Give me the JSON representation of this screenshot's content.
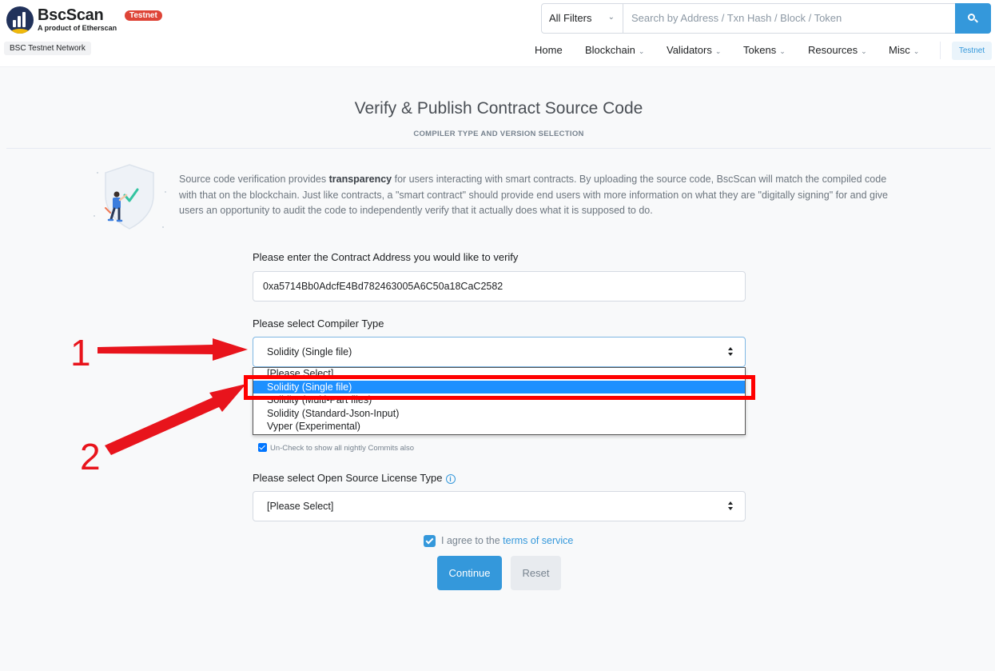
{
  "header": {
    "logo_name": "BscScan",
    "logo_sub": "A product of Etherscan",
    "testnet_badge": "Testnet",
    "network_label": "BSC Testnet Network",
    "search": {
      "filter_value": "All Filters",
      "placeholder": "Search by Address / Txn Hash / Block / Token",
      "button_icon": "search-icon"
    },
    "nav": [
      {
        "label": "Home",
        "caret": ""
      },
      {
        "label": "Blockchain",
        "caret": "⌄"
      },
      {
        "label": "Validators",
        "caret": "⌄"
      },
      {
        "label": "Tokens",
        "caret": "⌄"
      },
      {
        "label": "Resources",
        "caret": "⌄"
      },
      {
        "label": "Misc",
        "caret": "⌄"
      }
    ],
    "network_chip": "Testnet"
  },
  "page": {
    "title": "Verify & Publish Contract Source Code",
    "subtitle": "COMPILER TYPE AND VERSION SELECTION",
    "intro_before": "Source code verification provides ",
    "intro_bold": "transparency",
    "intro_after": " for users interacting with smart contracts. By uploading the source code, BscScan will match the compiled code with that on the blockchain. Just like contracts, a \"smart contract\" should provide end users with more information on what they are \"digitally signing\" for and give users an opportunity to audit the code to independently verify that it actually does what it is supposed to do."
  },
  "form": {
    "address_label": "Please enter the Contract Address you would like to verify",
    "address_value": "0xa5714Bb0AdcfE4Bd782463005A6C50a18CaC2582",
    "compiler_type_label": "Please select Compiler Type",
    "compiler_type_value": "Solidity (Single file)",
    "compiler_type_options": [
      "[Please Select]",
      "Solidity (Single file)",
      "Solidity (Multi-Part files)",
      "Solidity (Standard-Json-Input)",
      "Vyper (Experimental)"
    ],
    "compiler_type_selected_index": 1,
    "nightly_checkbox_label": "Un-Check to show all nightly Commits also",
    "nightly_checked": true,
    "license_label": "Please select Open Source License Type",
    "license_value": "[Please Select]",
    "agree_prefix": "I agree to the ",
    "agree_link": "terms of service",
    "agree_checked": true,
    "continue_label": "Continue",
    "reset_label": "Reset"
  },
  "annotations": {
    "label_1": "1",
    "label_2": "2",
    "color": "#e8141c"
  },
  "colors": {
    "accent": "#3498db",
    "brand_dark": "#21325b",
    "brand_gold": "#f0b90b",
    "badge_red": "#de4437",
    "dropdown_highlight": "#1e90ff"
  }
}
